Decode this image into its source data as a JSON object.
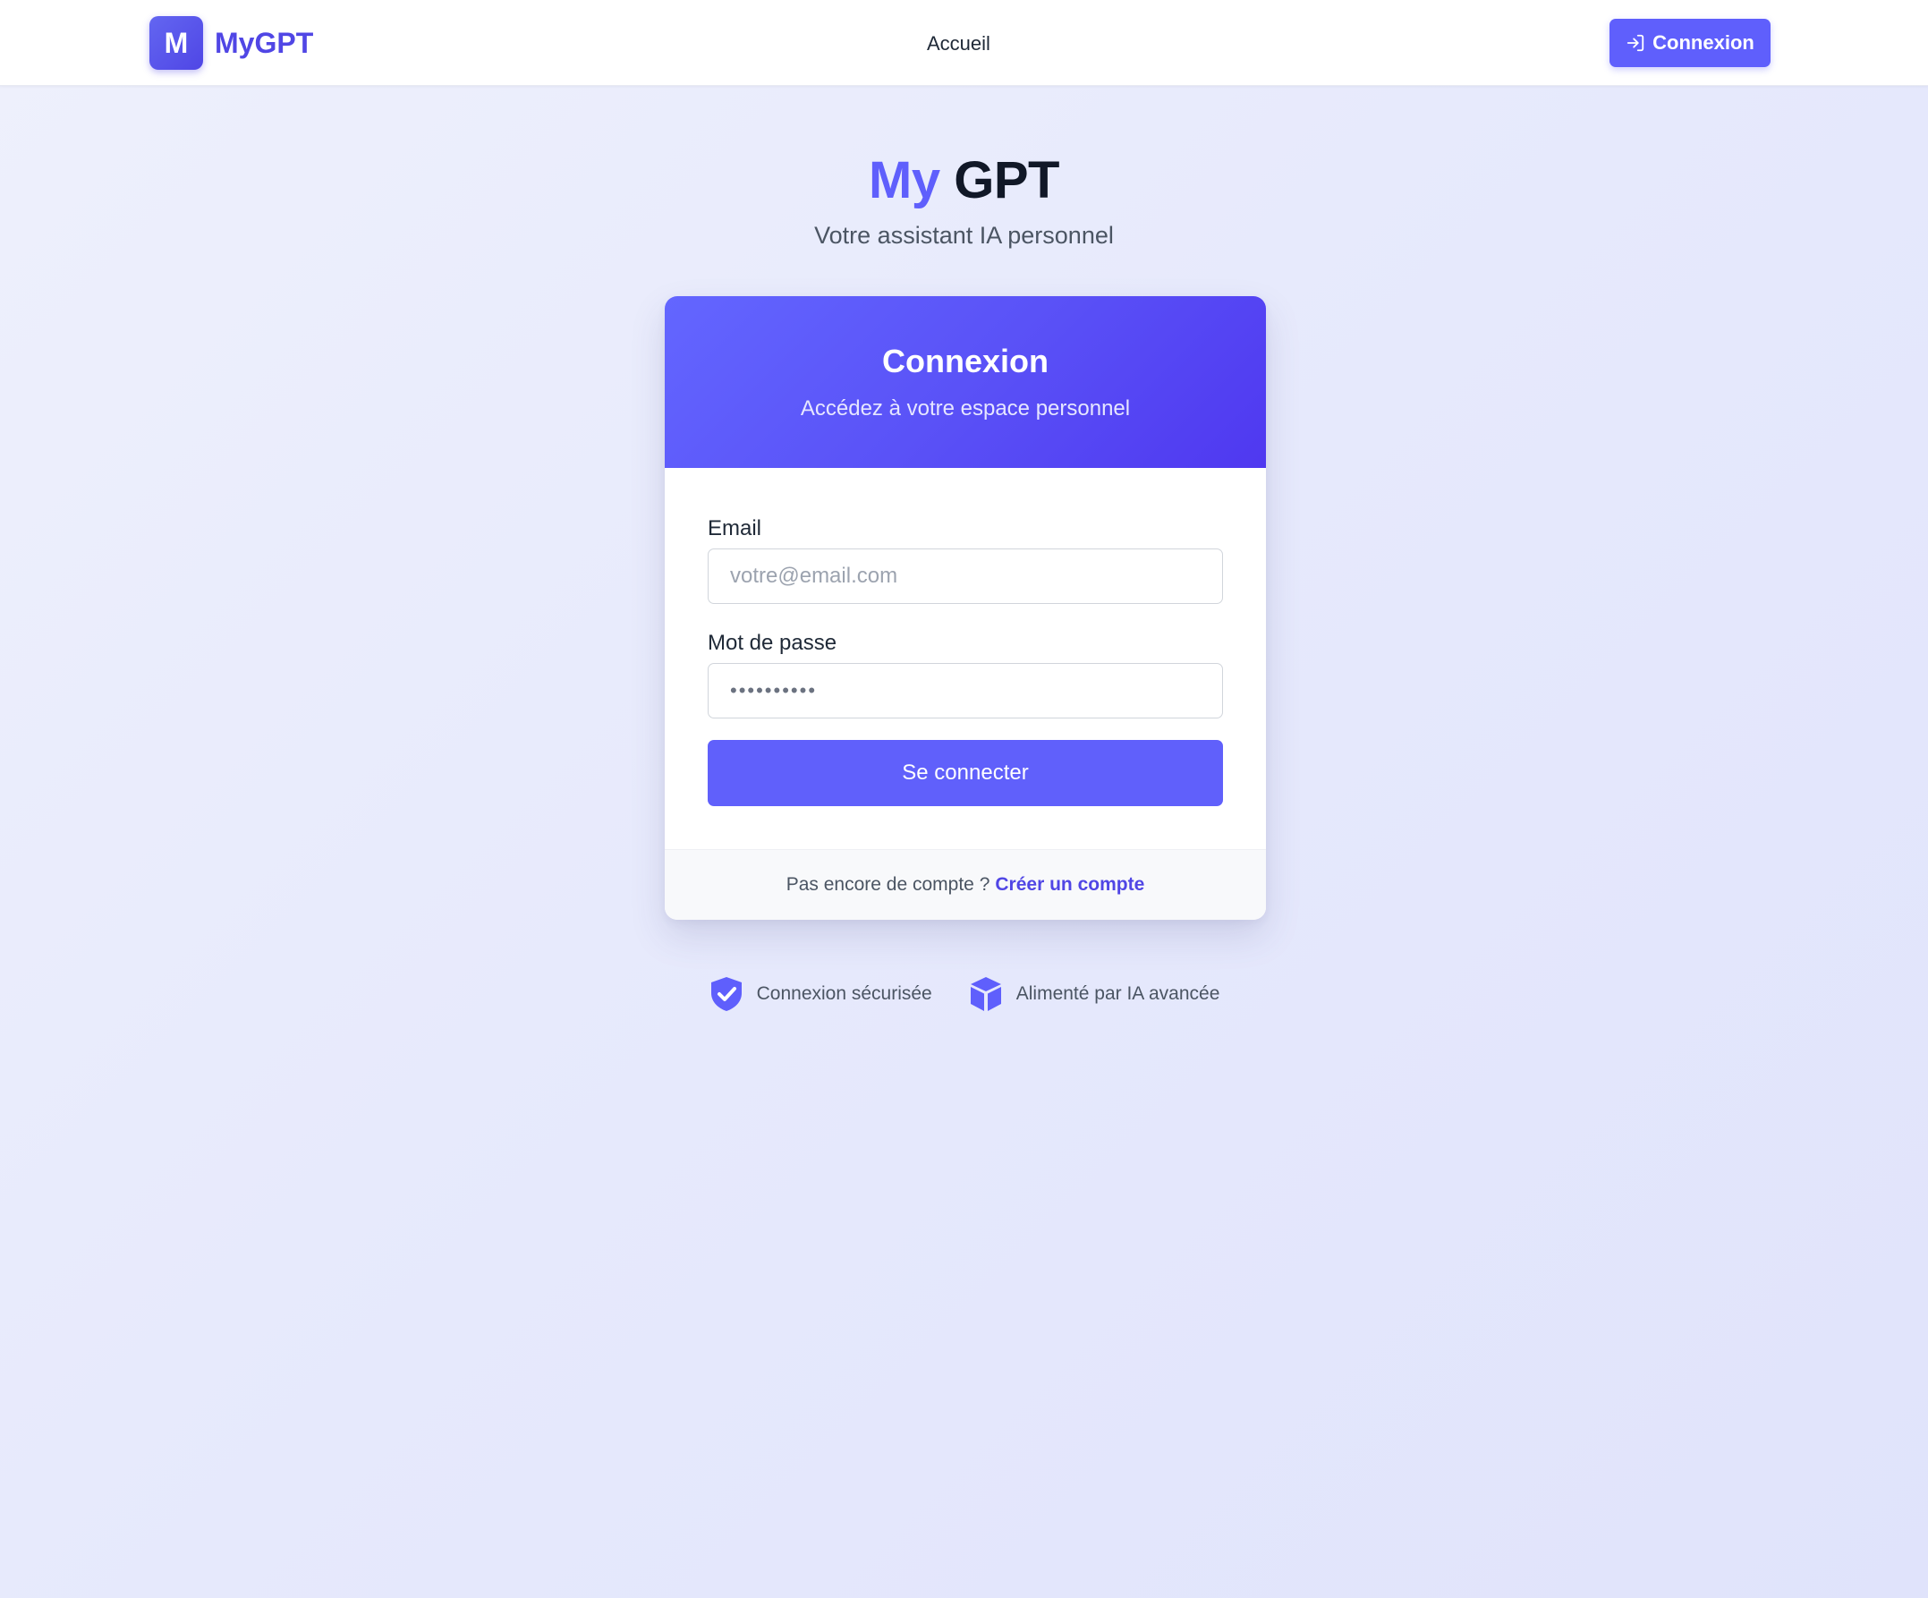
{
  "navbar": {
    "logo_letter": "M",
    "brand": "MyGPT",
    "home_link": "Accueil",
    "login_button": "Connexion"
  },
  "hero": {
    "title_part1": "My",
    "title_part2": "GPT",
    "subtitle": "Votre assistant IA personnel"
  },
  "login_card": {
    "title": "Connexion",
    "subtitle": "Accédez à votre espace personnel",
    "email_label": "Email",
    "email_placeholder": "votre@email.com",
    "password_label": "Mot de passe",
    "password_value": "••••••••••",
    "submit_label": "Se connecter",
    "footer_text": "Pas encore de compte ?",
    "signup_link": "Créer un compte"
  },
  "features": [
    {
      "icon": "shield-check-icon",
      "label": "Connexion sécurisée"
    },
    {
      "icon": "cube-icon",
      "label": "Alimenté par IA avancée"
    }
  ],
  "colors": {
    "primary": "#5f5ffc",
    "brand_text": "#5046e5",
    "dark_text": "#111827"
  }
}
